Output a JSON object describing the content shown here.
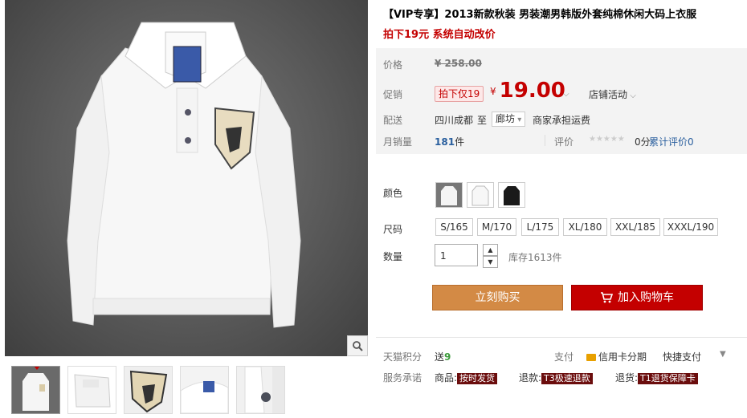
{
  "gallery": {
    "zoom_icon": "magnifier-icon",
    "thumbnails": [
      "thumb-front",
      "thumb-folded",
      "thumb-badge",
      "thumb-collar",
      "thumb-button"
    ]
  },
  "product": {
    "title": "【VIP专享】2013新款秋装 男装潮男韩版外套纯棉休闲大码上衣服",
    "subtitle": "拍下19元 系统自动改价"
  },
  "pricing": {
    "price_label": "价格",
    "original_price": "¥ 258.00",
    "promo_label": "促销",
    "promo_tag": "拍下仅19",
    "currency": "¥",
    "promo_price": "19.00",
    "store_activity": "店铺活动",
    "delivery_label": "配送",
    "from": "四川成都",
    "to_word": "至",
    "destination": "廊坊",
    "shipping": "商家承担运费",
    "monthly_sales_label": "月销量",
    "monthly_sales_count": "181",
    "monthly_sales_unit": "件",
    "rating_label": "评价",
    "rating_stars": "★★★★★",
    "rating_score": "0分",
    "review_link": "累计评价",
    "review_count": "0"
  },
  "options": {
    "color_label": "颜色",
    "colors": [
      "white-shirt",
      "white-shirt-2",
      "black-shirt"
    ],
    "size_label": "尺码",
    "sizes": [
      "S/165",
      "M/170",
      "L/175",
      "XL/180",
      "XXL/185",
      "XXXL/190"
    ],
    "quantity_label": "数量",
    "quantity_value": "1",
    "stock": "库存1613件"
  },
  "actions": {
    "buy_now": "立刻购买",
    "add_to_cart": "加入购物车"
  },
  "extras": {
    "points_label": "天猫积分",
    "points_prefix": "送",
    "points_value": "9",
    "pay_label": "支付",
    "credit_card": "信用卡分期",
    "quick_pay": "快捷支付",
    "service_label": "服务承诺",
    "goods_label": "商品:",
    "goods_tag": "按时发货",
    "refund_label": "退款:",
    "refund_tag": "T3极速退款",
    "return_label": "退货:",
    "return_tag": "T1退货保障卡"
  }
}
